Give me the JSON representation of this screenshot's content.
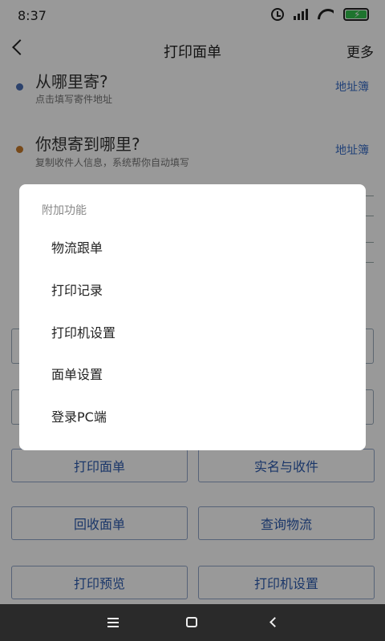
{
  "status_bar": {
    "time": "8:37"
  },
  "header": {
    "title": "打印面单",
    "more_label": "更多"
  },
  "sender": {
    "title": "从哪里寄?",
    "subtitle": "点击填写寄件地址",
    "book_label": "地址簿",
    "dot_color": "#4a6fb5"
  },
  "recipient": {
    "title": "你想寄到哪里?",
    "subtitle": "复制收件人信息，系统帮你自动填写",
    "book_label": "地址簿",
    "dot_color": "#c77a2a"
  },
  "buttons": [
    {
      "label": "打印面单"
    },
    {
      "label": "实名与收件"
    },
    {
      "label": "回收面单"
    },
    {
      "label": "查询物流"
    },
    {
      "label": "打印预览"
    },
    {
      "label": "打印机设置"
    }
  ],
  "dialog": {
    "title": "附加功能",
    "items": [
      {
        "label": "物流跟单"
      },
      {
        "label": "打印记录"
      },
      {
        "label": "打印机设置"
      },
      {
        "label": "面单设置"
      },
      {
        "label": "登录PC端"
      }
    ]
  },
  "colors": {
    "accent": "#2c5bb0",
    "overlay": "rgba(0,0,0,0.40)",
    "battery": "#33c24d"
  }
}
